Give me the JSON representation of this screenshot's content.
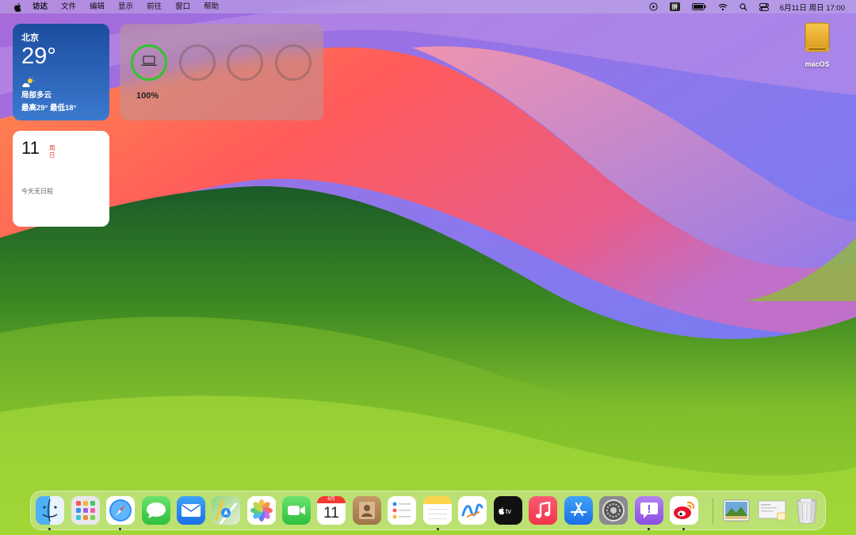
{
  "menubar": {
    "app_name": "访达",
    "menus": [
      "文件",
      "编辑",
      "显示",
      "前往",
      "窗口",
      "帮助"
    ],
    "ime_label": "拼",
    "datetime": "6月11日 周日  17:00"
  },
  "widgets": {
    "weather": {
      "city": "北京",
      "temperature": "29°",
      "condition": "局部多云",
      "high_low": "最高29° 最低18°"
    },
    "battery": {
      "percent_label": "100%",
      "level": 1.0
    },
    "calendar": {
      "day": "11",
      "weekday": "周日",
      "no_events": "今天无日程"
    }
  },
  "desktop": {
    "drive_label": "macOS"
  },
  "dock": {
    "calendar_month": "6月",
    "calendar_day": "11",
    "apps": [
      {
        "name": "finder",
        "running": true
      },
      {
        "name": "launchpad",
        "running": false
      },
      {
        "name": "safari",
        "running": true
      },
      {
        "name": "messages",
        "running": false
      },
      {
        "name": "mail",
        "running": false
      },
      {
        "name": "maps",
        "running": false
      },
      {
        "name": "photos",
        "running": false
      },
      {
        "name": "facetime",
        "running": false
      },
      {
        "name": "calendar",
        "running": true
      },
      {
        "name": "contacts",
        "running": false
      },
      {
        "name": "reminders",
        "running": false
      },
      {
        "name": "notes",
        "running": false
      },
      {
        "name": "freeform",
        "running": false
      },
      {
        "name": "apple-tv",
        "running": false
      },
      {
        "name": "music",
        "running": false
      },
      {
        "name": "app-store",
        "running": false
      },
      {
        "name": "system-settings",
        "running": false
      },
      {
        "name": "feedback-assistant",
        "running": true
      },
      {
        "name": "weibo",
        "running": true
      },
      {
        "name": "preview-image",
        "running": false
      },
      {
        "name": "document-stack",
        "running": false
      },
      {
        "name": "trash",
        "running": false
      }
    ]
  },
  "colors": {
    "battery_ring": "#2fc42f",
    "calendar_red": "#e23b2f"
  }
}
